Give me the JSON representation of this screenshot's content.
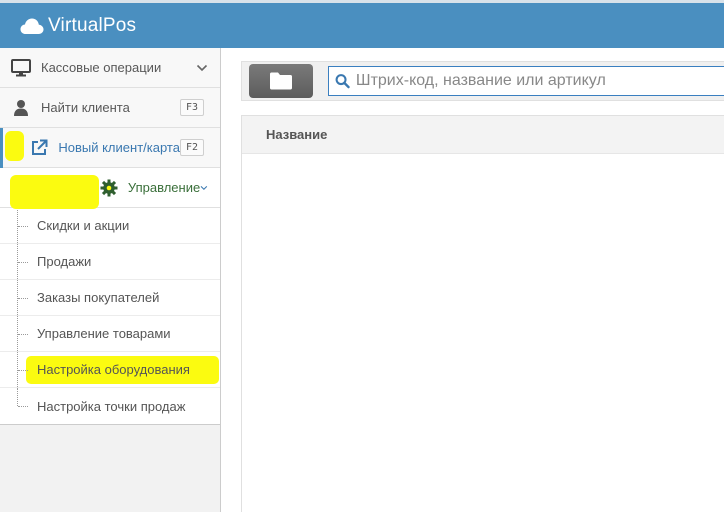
{
  "app": {
    "title": "VirtualPos",
    "logo_icon": "cloud-icon"
  },
  "sidebar": {
    "items": [
      {
        "label": "Кассовые операции",
        "icon": "monitor-icon",
        "has_chevron": true
      },
      {
        "label": "Найти клиента",
        "icon": "user-icon",
        "shortcut": "F3"
      },
      {
        "label": "Новый клиент/карта",
        "icon": "external-link-icon",
        "shortcut": "F2"
      },
      {
        "label": "Управление",
        "icon": "gear-icon",
        "has_chevron": true,
        "expanded": true
      }
    ],
    "submenu": [
      {
        "label": "Скидки и акции"
      },
      {
        "label": "Продажи"
      },
      {
        "label": "Заказы покупателей"
      },
      {
        "label": "Управление товарами"
      },
      {
        "label": "Настройка оборудования",
        "highlighted": true
      },
      {
        "label": "Настройка точки продаж"
      }
    ]
  },
  "toolbar": {
    "folder_icon": "folder-icon",
    "search": {
      "placeholder": "Штрих-код, название или артикул",
      "value": ""
    }
  },
  "table": {
    "columns": [
      "Название"
    ]
  },
  "colors": {
    "topbar": "#4a8fc0",
    "highlight": "#fbfb10",
    "link_blue": "#3a78b0",
    "gear_green": "#3a6f3a"
  }
}
